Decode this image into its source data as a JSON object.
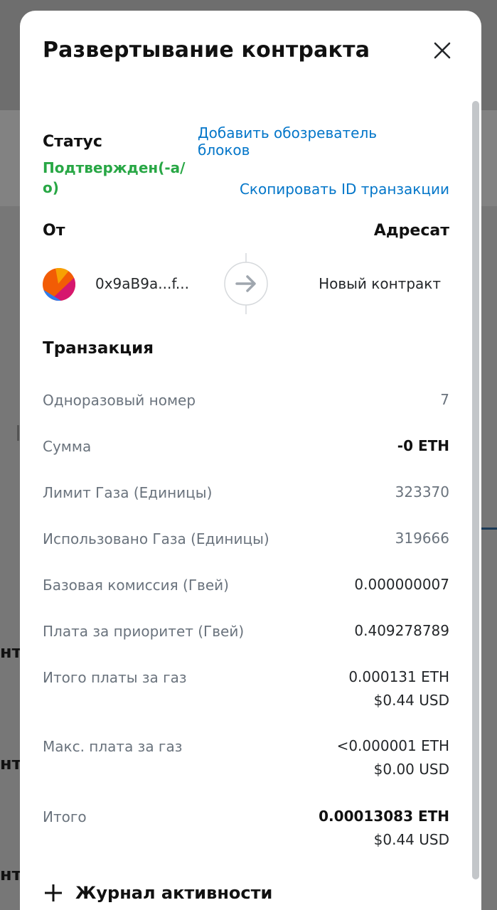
{
  "background": {
    "fragments": [
      "нт",
      "нт",
      "нт"
    ]
  },
  "modal": {
    "title": "Развертывание контракта",
    "status_label": "Статус",
    "status_value": "Подтвержден(-а/о)",
    "explorer_link": "Добавить обозреватель блоков",
    "copy_tx_link": "Скопировать ID транзакции",
    "from_label": "От",
    "to_label": "Адресат",
    "from_address": "0x9aB9a...f...",
    "to_value": "Новый контракт",
    "transaction_heading": "Транзакция",
    "rows": [
      {
        "label": "Одноразовый номер",
        "value": "7"
      },
      {
        "label": "Сумма",
        "value": "-0 ETH"
      },
      {
        "label": "Лимит Газа (Единицы)",
        "value": "323370"
      },
      {
        "label": "Использовано Газа (Единицы)",
        "value": "319666"
      },
      {
        "label": "Базовая комиссия (Гвей)",
        "value": "0.000000007"
      },
      {
        "label": "Плата за приоритет (Гвей)",
        "value": "0.409278789"
      },
      {
        "label": "Итого платы за газ",
        "value": "0.000131 ETH",
        "value2": "$0.44 USD"
      },
      {
        "label": "Макс. плата за газ",
        "value": "<0.000001 ETH",
        "value2": "$0.00 USD"
      },
      {
        "label": "Итого",
        "value": "0.00013083 ETH",
        "value2": "$0.44 USD"
      }
    ],
    "activity_log": "Журнал активности"
  },
  "colors": {
    "status_green": "#28a745",
    "link_blue": "#0376c9",
    "muted_gray": "#6a737d"
  }
}
